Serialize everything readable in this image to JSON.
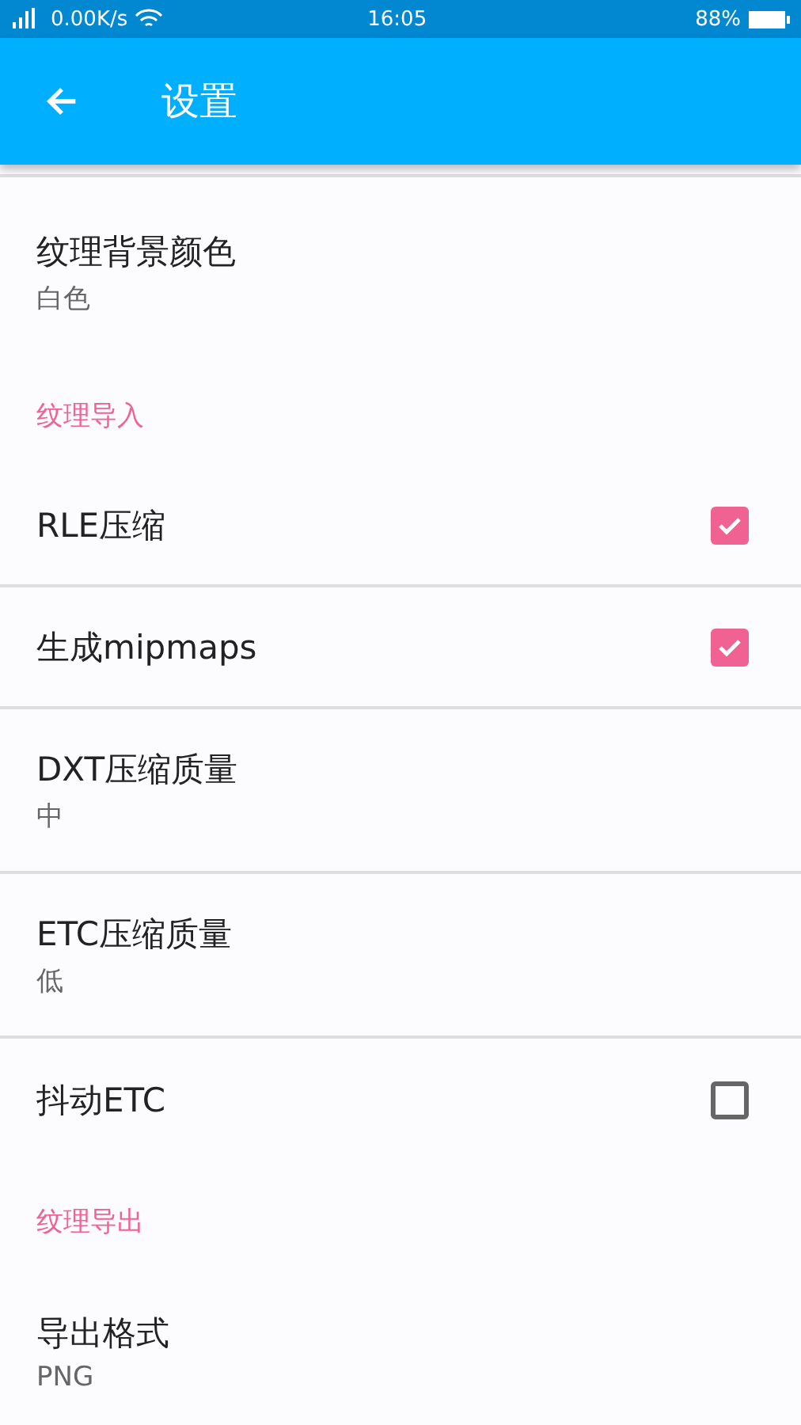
{
  "status_bar": {
    "speed": "0.00K/s",
    "time": "16:05",
    "battery": "88%"
  },
  "app_bar": {
    "title": "设置"
  },
  "items": [
    {
      "kind": "pref",
      "title": "纹理背景颜色",
      "summary": "白色"
    },
    {
      "kind": "category",
      "title": "纹理导入"
    },
    {
      "kind": "check",
      "title": "RLE压缩",
      "checked": true
    },
    {
      "kind": "check",
      "title": "生成mipmaps",
      "checked": true
    },
    {
      "kind": "pref",
      "title": "DXT压缩质量",
      "summary": "中"
    },
    {
      "kind": "pref",
      "title": "ETC压缩质量",
      "summary": "低"
    },
    {
      "kind": "check",
      "title": "抖动ETC",
      "checked": false
    },
    {
      "kind": "category",
      "title": "纹理导出"
    },
    {
      "kind": "pref",
      "title": "导出格式",
      "summary": "PNG"
    }
  ]
}
